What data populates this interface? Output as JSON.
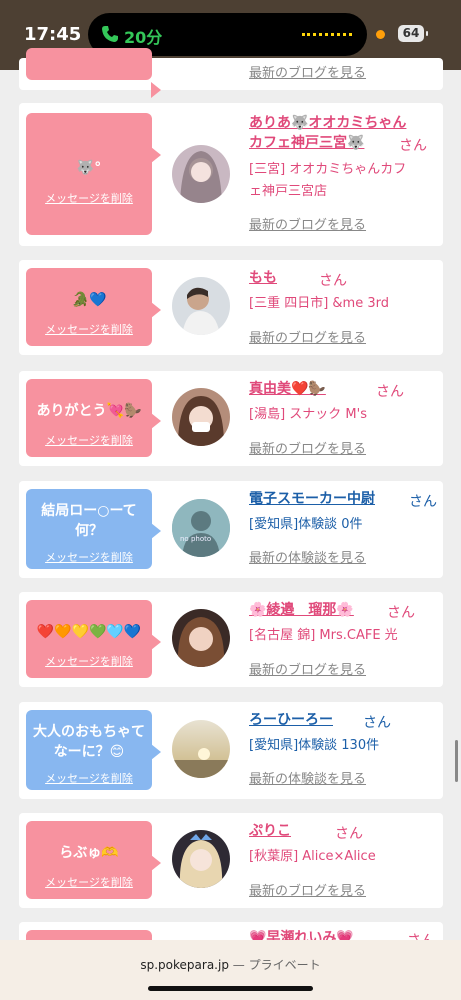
{
  "status_bar": {
    "time": "17:45",
    "call_duration": "20分",
    "battery": "64"
  },
  "top_partial": {
    "link": "最新のブログを見る"
  },
  "cards": [
    {
      "message": "🐺°",
      "delete_label": "メッセージを削除",
      "name_line1": "ありあ🐺オオカミちゃん",
      "name_line2": "カフェ神戸三宮🐺",
      "san": "さん",
      "shop_line1": "[三宮] オオカミちゃんカフ",
      "shop_line2": "ェ神戸三宮店",
      "link": "最新のブログを見る"
    },
    {
      "message": "🐊💙",
      "delete_label": "メッセージを削除",
      "name": "もも",
      "san": "さん",
      "shop": "[三重 四日市] &me 3rd",
      "link": "最新のブログを見る"
    },
    {
      "message": "ありがとう💘🦫",
      "delete_label": "メッセージを削除",
      "name": "真由美❤️🦫",
      "san": "さん",
      "shop": "[湯島] スナック M's",
      "link": "最新のブログを見る"
    },
    {
      "message_line1": "結局ロー○ーて",
      "message_line2": "何？",
      "delete_label": "メッセージを削除",
      "avatar_text": "no photo",
      "name": "電子スモーカー中尉",
      "san": "さん",
      "shop": "[愛知県]体験談 0件",
      "link": "最新の体験談を見る"
    },
    {
      "message": "❤️🧡💛💚🩵💙",
      "delete_label": "メッセージを削除",
      "name": "🌸綾邉　瑠那🌸",
      "san": "さん",
      "shop": "[名古屋 錦] Mrs.CAFE 光",
      "link": "最新のブログを見る"
    },
    {
      "message_line1": "大人のおもちゃて",
      "message_line2": "なーに？😊",
      "delete_label": "メッセージを削除",
      "name": "ろーひーろー",
      "san": "さん",
      "shop": "[愛知県]体験談 130件",
      "link": "最新の体験談を見る"
    },
    {
      "message": "らぶゅ🫶",
      "delete_label": "メッセージを削除",
      "name": "ぷりこ",
      "san": "さん",
      "shop": "[秋葉原] Alice×Alice",
      "link": "最新のブログを見る"
    }
  ],
  "bottom_partial": {
    "name": "💗早瀬れいみ💗",
    "san": "さん"
  },
  "browser": {
    "domain": "sp.pokepara.jp",
    "private_label": "— プライベート"
  }
}
